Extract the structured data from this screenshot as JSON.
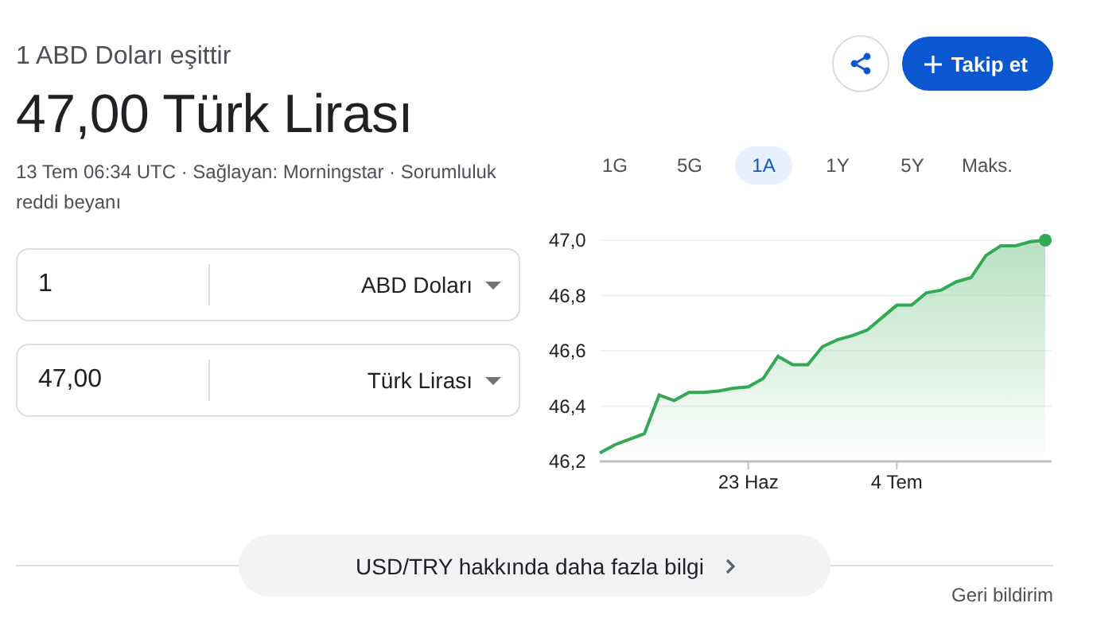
{
  "header": {
    "subtitle": "1 ABD Doları eşittir",
    "result": "47,00 Türk Lirası",
    "meta": "13 Tem 06:34 UTC · Sağlayan: Morningstar · Sorumluluk reddi beyanı"
  },
  "actions": {
    "follow_label": "Takip et"
  },
  "converters": [
    {
      "value": "1",
      "unit": "ABD Doları"
    },
    {
      "value": "47,00",
      "unit": "Türk Lirası"
    }
  ],
  "ranges": [
    {
      "label": "1G",
      "selected": false
    },
    {
      "label": "5G",
      "selected": false
    },
    {
      "label": "1A",
      "selected": true
    },
    {
      "label": "1Y",
      "selected": false
    },
    {
      "label": "5Y",
      "selected": false
    },
    {
      "label": "Maks.",
      "selected": false
    }
  ],
  "chart_data": {
    "type": "area",
    "categories": [
      null,
      null,
      null,
      null,
      null,
      null,
      null,
      null,
      null,
      null,
      "23 Haz",
      null,
      null,
      null,
      null,
      null,
      null,
      null,
      null,
      null,
      "4 Tem",
      null,
      null,
      null,
      null,
      null,
      null,
      null,
      null,
      null,
      null
    ],
    "series": [
      {
        "color": "#34a853",
        "values": [
          46.23,
          46.26,
          46.28,
          46.3,
          46.44,
          46.42,
          46.45,
          46.45,
          46.455,
          46.465,
          46.47,
          46.5,
          46.58,
          46.55,
          46.55,
          46.615,
          46.64,
          46.655,
          46.675,
          46.72,
          46.765,
          46.765,
          46.81,
          46.82,
          46.85,
          46.865,
          46.945,
          46.98,
          46.98,
          46.995,
          47.0
        ]
      }
    ],
    "ylim": [
      46.2,
      47.0
    ],
    "grid": true,
    "yticks": [
      {
        "value": 47.0,
        "label": "47,0"
      },
      {
        "value": 46.8,
        "label": "46,8"
      },
      {
        "value": 46.6,
        "label": "46,6"
      },
      {
        "value": 46.4,
        "label": "46,4"
      },
      {
        "value": 46.2,
        "label": "46,2"
      }
    ]
  },
  "footer": {
    "more_label": "USD/TRY hakkında daha fazla bilgi",
    "feedback": "Geri bildirim"
  }
}
